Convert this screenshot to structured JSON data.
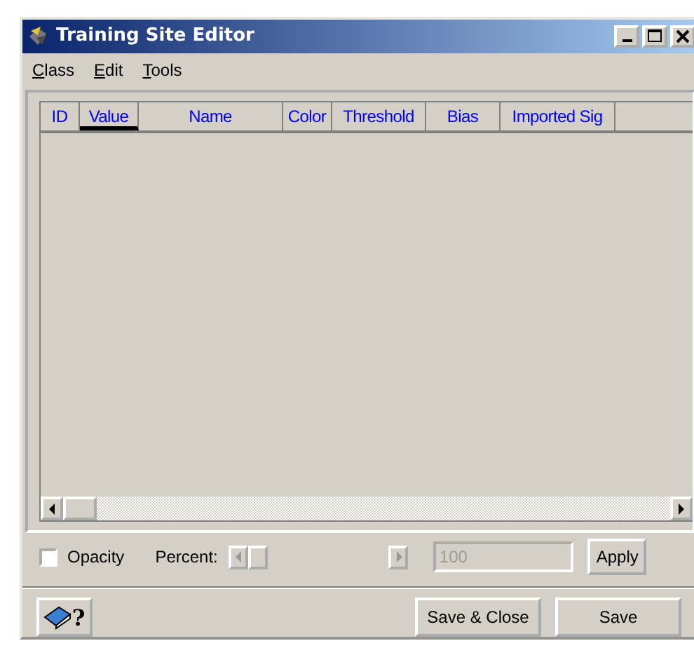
{
  "window": {
    "title": "Training Site Editor"
  },
  "menu": [
    {
      "label": "Class"
    },
    {
      "label": "Edit"
    },
    {
      "label": "Tools"
    }
  ],
  "table": {
    "columns": [
      {
        "label": "ID",
        "sorted": false
      },
      {
        "label": "Value",
        "sorted": true
      },
      {
        "label": "Name",
        "sorted": false
      },
      {
        "label": "Color",
        "sorted": false
      },
      {
        "label": "Threshold",
        "sorted": false
      },
      {
        "label": "Bias",
        "sorted": false
      },
      {
        "label": "Imported Sig",
        "sorted": false
      }
    ]
  },
  "opacity": {
    "label": "Opacity",
    "checked": false
  },
  "percent": {
    "label": "Percent:",
    "level": 0,
    "disabled": true,
    "value": "100"
  },
  "apply_button": "Apply",
  "help_button": {
    "glyph": "?"
  },
  "buttons": [
    "Save & Close",
    "Save"
  ]
}
